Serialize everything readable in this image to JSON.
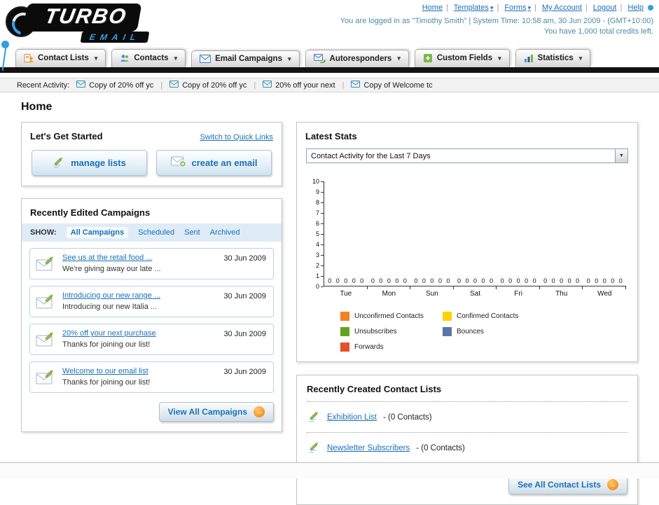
{
  "header": {
    "logo_primary": "TURBO",
    "logo_secondary": "EMAIL",
    "links": [
      {
        "label": "Home"
      },
      {
        "label": "Templates"
      },
      {
        "label": "Forms"
      },
      {
        "label": "My Account"
      },
      {
        "label": "Logout"
      },
      {
        "label": "Help"
      }
    ],
    "login_info": "You are logged in as \"Timothy Smith\" | System Time: 10:58 am, 30 Jun 2009 - (GMT+10:00)",
    "credits": "You have 1,000 total credits left."
  },
  "nav": {
    "tabs": [
      {
        "label": "Contact Lists"
      },
      {
        "label": "Contacts"
      },
      {
        "label": "Email Campaigns"
      },
      {
        "label": "Autoresponders"
      },
      {
        "label": "Custom Fields"
      },
      {
        "label": "Statistics"
      }
    ]
  },
  "recent_activity": {
    "label": "Recent Activity:",
    "items": [
      {
        "label": "Copy of 20% off yc"
      },
      {
        "label": "Copy of 20% off yc"
      },
      {
        "label": "20% off your next"
      },
      {
        "label": "Copy of Welcome tc"
      }
    ]
  },
  "page": {
    "title": "Home"
  },
  "get_started": {
    "title": "Let's Get Started",
    "switch_link": "Switch to Quick Links",
    "manage_lists": "manage lists",
    "create_email": "create an email"
  },
  "campaigns": {
    "title": "Recently Edited Campaigns",
    "show_label": "SHOW:",
    "filters": [
      {
        "label": "All Campaigns"
      },
      {
        "label": "Scheduled"
      },
      {
        "label": "Sent"
      },
      {
        "label": "Archived"
      }
    ],
    "items": [
      {
        "title": "See us at the retail food ...",
        "subtitle": "We're giving away our late ...",
        "date": "30 Jun 2009"
      },
      {
        "title": "Introducing our new range ...",
        "subtitle": "Introducing our new Italia ...",
        "date": "30 Jun 2009"
      },
      {
        "title": "20% off your next purchase",
        "subtitle": "Thanks for joining our list!",
        "date": "30 Jun 2009"
      },
      {
        "title": "Welcome to our email list",
        "subtitle": "Thanks for joining our list!",
        "date": "30 Jun 2009"
      }
    ],
    "view_all_label": "View All Campaigns"
  },
  "stats": {
    "title": "Latest Stats",
    "selected_option": "Contact Activity for the Last 7 Days",
    "chart_data": {
      "type": "bar",
      "title": "Contact Activity for the Last 7 Days",
      "categories": [
        "Tue",
        "Mon",
        "Sun",
        "Sat",
        "Fri",
        "Thu",
        "Wed"
      ],
      "series": [
        {
          "name": "Unconfirmed Contacts",
          "color": "#F58220",
          "values": [
            0,
            0,
            0,
            0,
            0,
            0,
            0
          ]
        },
        {
          "name": "Confirmed Contacts",
          "color": "#FFD200",
          "values": [
            0,
            0,
            0,
            0,
            0,
            0,
            0
          ]
        },
        {
          "name": "Unsubscribes",
          "color": "#62A420",
          "values": [
            0,
            0,
            0,
            0,
            0,
            0,
            0
          ]
        },
        {
          "name": "Bounces",
          "color": "#5B76A8",
          "values": [
            0,
            0,
            0,
            0,
            0,
            0,
            0
          ]
        },
        {
          "name": "Forwards",
          "color": "#E8502A",
          "values": [
            0,
            0,
            0,
            0,
            0,
            0,
            0
          ]
        }
      ],
      "ylim": [
        0,
        10
      ],
      "grid": false,
      "legend_position": "bottom"
    },
    "legend": [
      {
        "label": "Unconfirmed Contacts",
        "color": "#F58220"
      },
      {
        "label": "Confirmed Contacts",
        "color": "#FFD200"
      },
      {
        "label": "Unsubscribes",
        "color": "#62A420"
      },
      {
        "label": "Bounces",
        "color": "#5B76A8"
      },
      {
        "label": "Forwards",
        "color": "#E8502A"
      }
    ]
  },
  "contact_lists": {
    "title": "Recently Created Contact Lists",
    "items": [
      {
        "name": "Exhibition List",
        "detail": "- (0 Contacts)"
      },
      {
        "name": "Newsletter Subscribers",
        "detail": "- (0 Contacts)"
      }
    ],
    "see_all_label": "See All Contact Lists"
  }
}
